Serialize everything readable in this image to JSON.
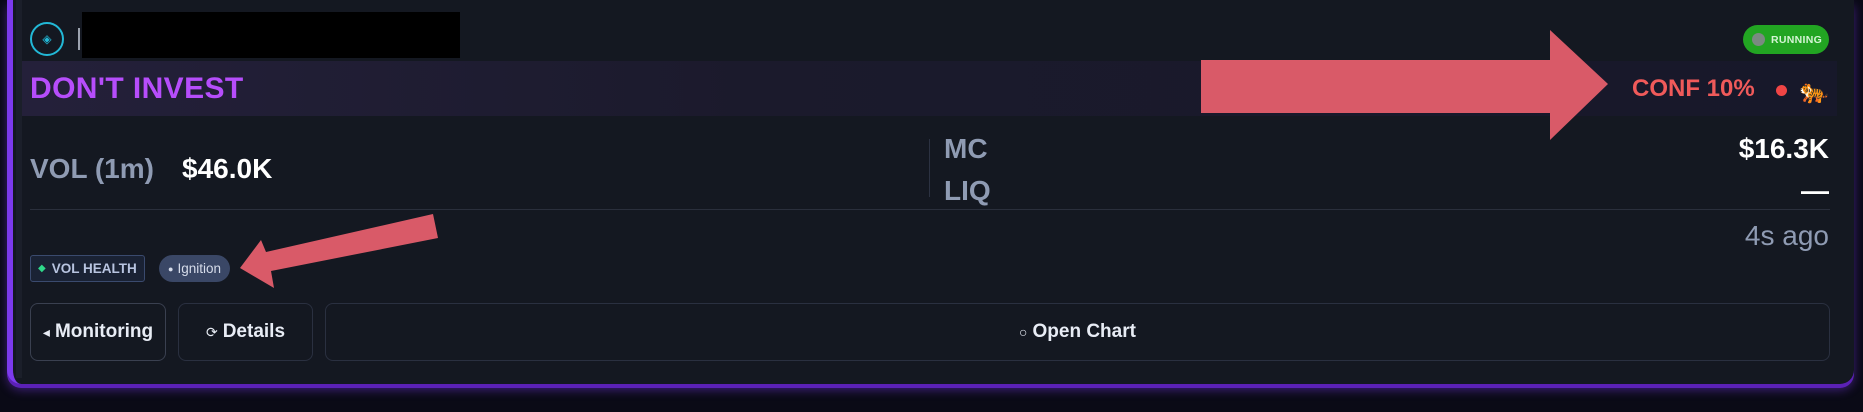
{
  "header": {
    "token_icon": "diamond-icon",
    "status_label": "RUNNING",
    "status_color": "#22a522"
  },
  "banner": {
    "headline": "DON'T INVEST",
    "headline_color": "#b64dfb",
    "confidence_label": "CONF 10%",
    "confidence_color": "#f05a5a",
    "mascot_icon": "tiger-icon",
    "mascot_glyph": "🐅"
  },
  "stats": {
    "volume_label": "VOL (1m)",
    "volume_value": "$46.0K",
    "mc_label": "MC",
    "mc_value": "$16.3K",
    "liq_label": "LIQ",
    "liq_value": "—"
  },
  "age": "4s ago",
  "tags": {
    "vol_health": "VOL HEALTH",
    "ignition": "Ignition"
  },
  "actions": {
    "monitoring": "Monitoring",
    "details": "Details",
    "open_chart": "Open Chart"
  },
  "annotation_color": "#d95a68"
}
